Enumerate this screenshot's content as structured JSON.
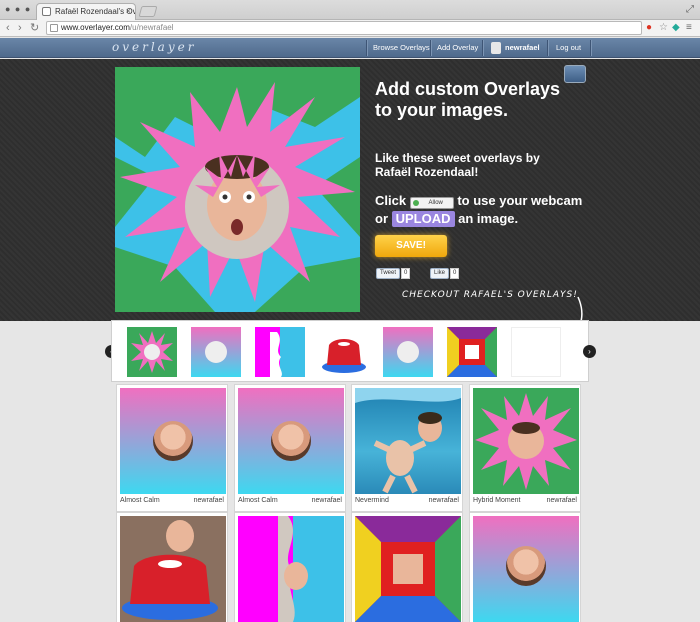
{
  "browser": {
    "tab_title": "Rafaël Rozendaal's Overlays",
    "tab_close": "×",
    "url_host": "www.overlayer.com",
    "url_path": "/u/newrafael",
    "back": "‹",
    "forward": "›",
    "reload": "↻"
  },
  "nav": {
    "logo": "overlayer",
    "browse": "Browse Overlays",
    "add": "Add Overlay",
    "user": "newrafael",
    "logout": "Log out"
  },
  "hero": {
    "headline": "Add custom Overlays to your images.",
    "subline": "Like these sweet overlays by Rafaël Rozendaal!",
    "click_prefix": "Click",
    "allow_label": "Allow",
    "click_mid": "to use your webcam or",
    "upload_label": "UPLOAD",
    "click_suffix": "an image.",
    "save_label": "SAVE!",
    "tweet_label": "Tweet",
    "tweet_count": "0",
    "like_label": "Like",
    "like_count": "0",
    "checkout_text": "CHECKOUT RAFAEL'S OVERLAYS!"
  },
  "carousel": {
    "prev": "‹",
    "next": "›",
    "thumbs": [
      "pink-burst",
      "gradient-circle",
      "pink-profile",
      "jelly-cake",
      "gradient-circle",
      "color-tunnel",
      "blank"
    ]
  },
  "overlays": [
    {
      "title": "Almost Calm",
      "user": "newrafael"
    },
    {
      "title": "Almost Calm",
      "user": "newrafael"
    },
    {
      "title": "Nevermind",
      "user": "newrafael"
    },
    {
      "title": "Hybrid Moment",
      "user": "newrafael"
    },
    {
      "title": "",
      "user": ""
    },
    {
      "title": "",
      "user": ""
    },
    {
      "title": "",
      "user": ""
    },
    {
      "title": "",
      "user": ""
    }
  ],
  "colors": {
    "nav_bg": "#5b7698",
    "hero_bg": "#2e2e2e",
    "save": "#f5b320",
    "upload": "#9a86e0",
    "pink": "#f06fc0",
    "cyan": "#3dc1e8",
    "green": "#3aa85a"
  }
}
